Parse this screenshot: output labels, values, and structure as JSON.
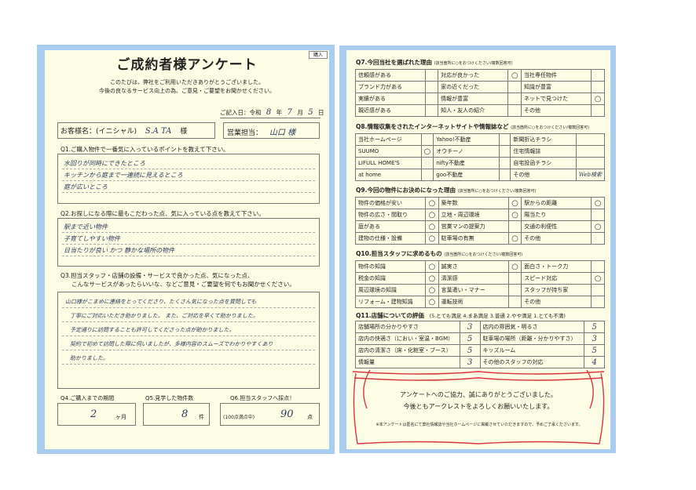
{
  "left": {
    "title": "ご成約者様アンケート",
    "intro_line1": "このたびは、弊社をご利用いただきありがとうございました。",
    "intro_line2": "今後の良なるサービス向上の為、ご意見・ご要望をお聞かせください。",
    "date_label": "ご記入日：令和",
    "date_year": "8",
    "date_year_unit": "年",
    "date_month": "7",
    "date_month_unit": "月",
    "date_day": "5",
    "date_day_unit": "日",
    "customer_label": "お客様名：(イニシャル)",
    "customer_value": "S.A  TA",
    "customer_suffix": "様",
    "staff_label": "営業担当：",
    "staff_value": "山口 様",
    "q1_label": "Q1.ご購入物件で一番気に入っているポイントを教えて下さい。",
    "q1_answers": [
      "水回りが同時にできたところ",
      "キッチンから庭まで一連続に見えるところ",
      "庭が広いところ"
    ],
    "q2_label": "Q2.お探しになる際に最もこだわった点、気に入っている点を教えて下さい。",
    "q2_answers": [
      "駅まで近い物件",
      "子育てしやすい物件",
      "日当たりが良い かつ 静かな場所の物件"
    ],
    "q3_label_line1": "Q3.担当スタッフ・店舗の設備・サービスで良かった点、気になった点、",
    "q3_label_line2": "こんなサービスがあったらいいな、などご意見・ご要望を何でもお聞かせください。",
    "q3_answers": [
      "山口様がこまめに連絡をとってくださり、たくさん気になった点を質問しても",
      "丁寧にご対応いただき助かりました。 また、ご対応を早くて助かりました。",
      "予定通りに訪問することも許可してくださった点が助かりました。",
      "契約で初めて訪問した際に伺いましたが、多様内容のスムーズでわかりやすくあり",
      "助かりました。"
    ],
    "q4_label": "Q4.ご購入までの期間",
    "q4_value": "2",
    "q4_unit": "ヶ月",
    "q5_label": "Q5.見学した物件数",
    "q5_value": "8",
    "q5_unit": "件",
    "q6_label": "Q6.担当スタッフへ採点！",
    "q6_prefix": "(100点満点中)",
    "q6_value": "90",
    "q6_unit": "点",
    "stamp": "購入"
  },
  "right": {
    "q7": {
      "label": "Q7.今回当社を選ばれた理由",
      "note": "(該当箇所に○をおつけください/複数回答可)",
      "rows": [
        [
          [
            "信頼感がある",
            ""
          ],
          [
            "対応が良かった",
            "○"
          ],
          [
            "当社専任物件",
            ""
          ]
        ],
        [
          [
            "ブランド力がある",
            ""
          ],
          [
            "家の近くだった",
            ""
          ],
          [
            "知識が豊富",
            ""
          ]
        ],
        [
          [
            "実績がある",
            ""
          ],
          [
            "情報が豊富",
            ""
          ],
          [
            "ネットで見つけた",
            "○"
          ]
        ],
        [
          [
            "親近感がある",
            ""
          ],
          [
            "知人・友人の紹介",
            ""
          ],
          [
            "その他",
            ""
          ]
        ]
      ]
    },
    "q8": {
      "label": "Q8.情報収集をされたインターネットサイトや情報誌など",
      "note": "(該当箇所に○をおつけください/複数回答可)",
      "rows": [
        [
          [
            "当社ホームページ",
            ""
          ],
          [
            "Yahoo!不動産",
            ""
          ],
          [
            "新聞折込チラシ",
            ""
          ]
        ],
        [
          [
            "SUUMO",
            "○"
          ],
          [
            "オウチーノ",
            ""
          ],
          [
            "住宅情報誌",
            ""
          ]
        ],
        [
          [
            "LIFULL HOME'S",
            ""
          ],
          [
            "nifty不動産",
            ""
          ],
          [
            "自宅投函チラシ",
            ""
          ]
        ],
        [
          [
            "at home",
            ""
          ],
          [
            "goo不動産",
            ""
          ],
          [
            "その他",
            "Web検索"
          ]
        ]
      ]
    },
    "q9": {
      "label": "Q9.今回の物件にお決めになった理由",
      "note": "(該当箇所に○をおつけください/複数回答可)",
      "rows": [
        [
          [
            "物件の価格が安い",
            "○"
          ],
          [
            "築年数",
            "○"
          ],
          [
            "駅からの距離",
            "○"
          ]
        ],
        [
          [
            "物件の広さ・間取り",
            "○"
          ],
          [
            "立地・周辺環境",
            "○"
          ],
          [
            "陽当たり",
            ""
          ]
        ],
        [
          [
            "庭がある",
            "○"
          ],
          [
            "営業マンの提案力",
            ""
          ],
          [
            "交通の利便性",
            "○"
          ]
        ],
        [
          [
            "建物の仕様・設備",
            "○"
          ],
          [
            "駐車場の有無",
            "○"
          ],
          [
            "その他",
            ""
          ]
        ]
      ]
    },
    "q10": {
      "label": "Q10.担当スタッフに求めるもの",
      "note": "(該当箇所に○をおつけください/複数回答可)",
      "rows": [
        [
          [
            "物件の知識",
            "○"
          ],
          [
            "誠実さ",
            "○"
          ],
          [
            "面白さ・トーク力",
            ""
          ]
        ],
        [
          [
            "税金の知識",
            "○"
          ],
          [
            "清潔感",
            ""
          ],
          [
            "スピード対応",
            "○"
          ]
        ],
        [
          [
            "周辺環境の知識",
            "○"
          ],
          [
            "言葉遣い・マナー",
            ""
          ],
          [
            "スタッフが持ち家",
            ""
          ]
        ],
        [
          [
            "リフォーム・建物知識",
            "○"
          ],
          [
            "運転技術",
            ""
          ],
          [
            "その他",
            ""
          ]
        ]
      ]
    },
    "q11": {
      "label": "Q11.店舗についての評価",
      "scale": "(5.とても満足  4.まあ満足  3.普通  2.やや満足  1.とても不満)",
      "rows": [
        [
          [
            "店舗場所の分かりやすさ",
            "3"
          ],
          [
            "店内の雰囲気・明るさ",
            "5"
          ]
        ],
        [
          [
            "店内の快適さ（におい・室温・BGM）",
            "5"
          ],
          [
            "駐車場の場所（距離・分かりやすさ）",
            "3"
          ]
        ],
        [
          [
            "店内の清潔さ（床・化粧室・ブース）",
            "5"
          ],
          [
            "キッズルーム",
            "5"
          ]
        ],
        [
          [
            "情報量",
            "3"
          ],
          [
            "その他のスタッフの対応",
            "4"
          ]
        ]
      ]
    },
    "thanks_line1": "アンケートへのご協力、誠にありがとうございました。",
    "thanks_line2": "今後ともアークレストをよろしくお願いいたします。",
    "footer_note": "※本アンケートは匿名にて弊社情報誌や当社ホームページに掲載させていただきますので、予めご了承くださいます。",
    "ribbon_color": "#d9363e"
  }
}
